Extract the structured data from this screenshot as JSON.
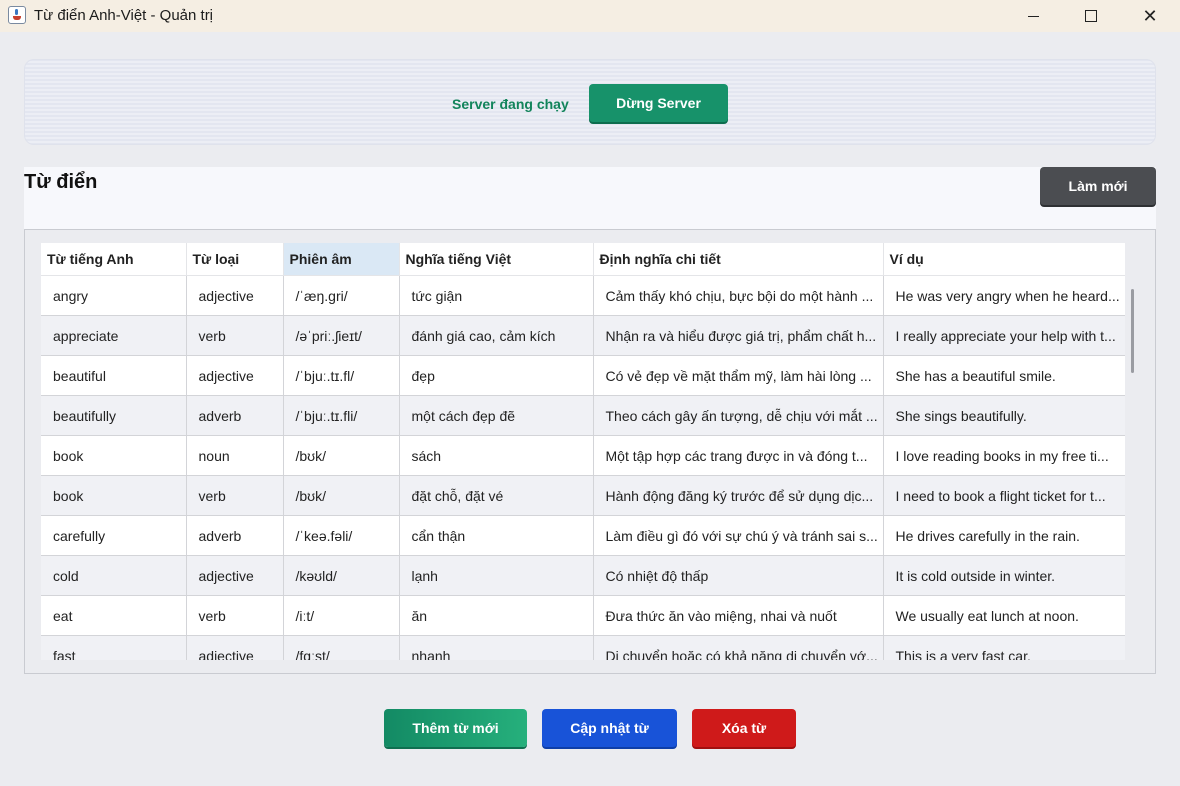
{
  "window": {
    "title": "Từ điển Anh-Việt - Quản trị"
  },
  "server": {
    "status": "Server đang chạy",
    "stop_label": "Dừng Server"
  },
  "dictionary": {
    "title": "Từ điển",
    "refresh_label": "Làm mới",
    "columns": [
      "Từ tiếng Anh",
      "Từ loại",
      "Phiên âm",
      "Nghĩa tiếng Việt",
      "Định nghĩa chi tiết",
      "Ví dụ"
    ],
    "selected_column": "Phiên âm",
    "rows": [
      [
        "angry",
        "adjective",
        "/ˈæŋ.ɡri/",
        "tức giận",
        "Cảm thấy khó chịu, bực bội do một hành ...",
        "He was very angry when he heard..."
      ],
      [
        "appreciate",
        "verb",
        "/əˈpriː.ʃieɪt/",
        "đánh giá cao, cảm kích",
        "Nhận ra và hiểu được giá trị, phẩm chất h...",
        "I really appreciate your help with t..."
      ],
      [
        "beautiful",
        "adjective",
        "/ˈbjuː.tɪ.fl/",
        "đẹp",
        "Có vẻ đẹp về mặt thẩm mỹ, làm hài lòng ...",
        "She has a beautiful smile."
      ],
      [
        "beautifully",
        "adverb",
        "/ˈbjuː.tɪ.fli/",
        "một cách đẹp đẽ",
        "Theo cách gây ấn tượng, dễ chịu với mắt ...",
        "She sings beautifully."
      ],
      [
        "book",
        "noun",
        "/bʊk/",
        "sách",
        "Một tập hợp các trang được in và đóng t...",
        "I love reading books in my free ti..."
      ],
      [
        "book",
        "verb",
        "/bʊk/",
        "đặt chỗ, đặt vé",
        "Hành động đăng ký trước để sử dụng dịc...",
        "I need to book a flight ticket for t..."
      ],
      [
        "carefully",
        "adverb",
        "/ˈkeə.fəli/",
        "cẩn thận",
        "Làm điều gì đó với sự chú ý và tránh sai s...",
        "He drives carefully in the rain."
      ],
      [
        "cold",
        "adjective",
        "/kəʊld/",
        "lạnh",
        "Có nhiệt độ thấp",
        "It is cold outside in winter."
      ],
      [
        "eat",
        "verb",
        "/iːt/",
        "ăn",
        "Đưa thức ăn vào miệng, nhai và nuốt",
        "We usually eat lunch at noon."
      ],
      [
        "fast",
        "adjective",
        "/fɑːst/",
        "nhanh",
        "Di chuyển hoặc có khả năng di chuyển vớ...",
        "This is a very fast car."
      ]
    ]
  },
  "actions": {
    "add_label": "Thêm từ mới",
    "update_label": "Cập nhật từ",
    "delete_label": "Xóa từ"
  }
}
